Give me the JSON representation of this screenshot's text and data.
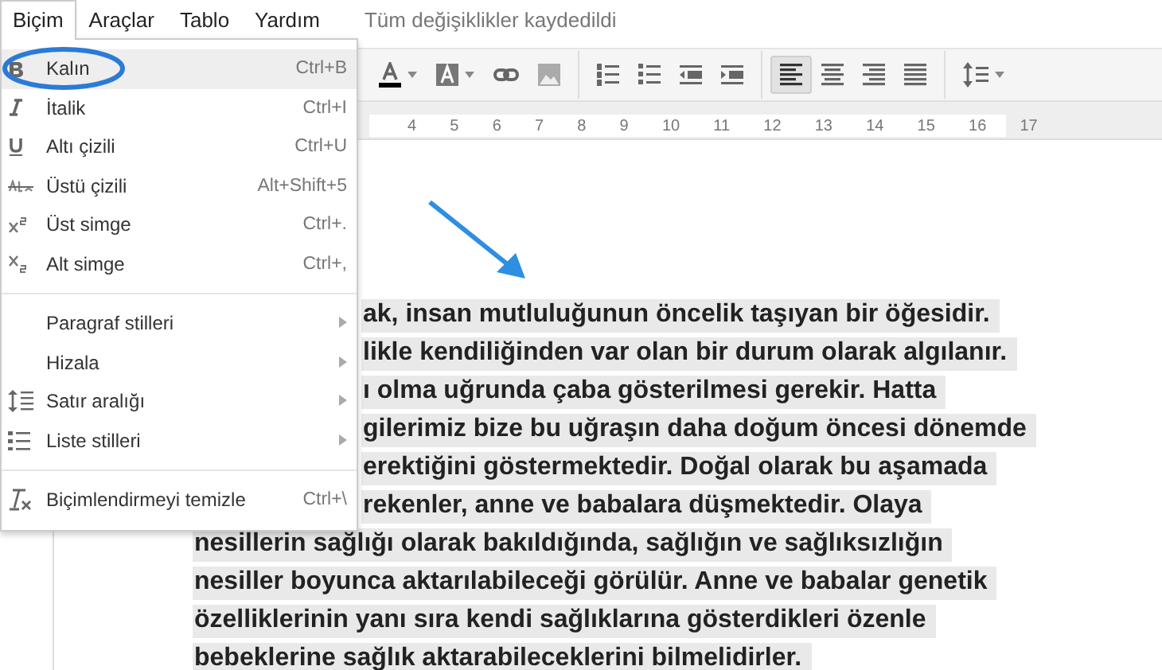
{
  "menubar": {
    "items": [
      {
        "label": "Biçim",
        "selected": true
      },
      {
        "label": "Araçlar",
        "selected": false
      },
      {
        "label": "Tablo",
        "selected": false
      },
      {
        "label": "Yardım",
        "selected": false
      }
    ],
    "status": "Tüm değişiklikler kaydedildi"
  },
  "format_menu": {
    "groups": [
      [
        {
          "kind": "command",
          "label": "Kalın",
          "shortcut": "Ctrl+B",
          "selected": true
        },
        {
          "kind": "command",
          "label": "İtalik",
          "shortcut": "Ctrl+I",
          "selected": false
        },
        {
          "kind": "command",
          "label": "Altı çizili",
          "shortcut": "Ctrl+U",
          "selected": false
        },
        {
          "kind": "command",
          "label": "Üstü çizili",
          "shortcut": "Alt+Shift+5",
          "selected": false
        },
        {
          "kind": "command",
          "label": "Üst simge",
          "shortcut": "Ctrl+.",
          "selected": false
        },
        {
          "kind": "command",
          "label": "Alt simge",
          "shortcut": "Ctrl+,",
          "selected": false
        }
      ],
      [
        {
          "kind": "submenu",
          "label": "Paragraf stilleri",
          "selected": false
        },
        {
          "kind": "submenu",
          "label": "Hizala",
          "selected": false
        },
        {
          "kind": "submenu",
          "label": "Satır aralığı",
          "selected": false
        },
        {
          "kind": "submenu",
          "label": "Liste stilleri",
          "selected": false
        }
      ],
      [
        {
          "kind": "command",
          "label": "Biçimlendirmeyi temizle",
          "shortcut": "Ctrl+\\",
          "selected": false
        }
      ]
    ]
  },
  "toolbar": {
    "align_buttons": [
      {
        "selected": true
      },
      {
        "selected": false
      },
      {
        "selected": false
      },
      {
        "selected": false
      }
    ]
  },
  "ruler": {
    "marks": [
      "4",
      "5",
      "6",
      "7",
      "8",
      "9",
      "10",
      "11",
      "12",
      "13",
      "14",
      "15",
      "16",
      "17"
    ]
  },
  "document": {
    "lines_beside_menu": [
      "ak, insan mutluluğunun öncelik taşıyan bir öğesidir.",
      "likle kendiliğinden var olan bir durum olarak algılanır.",
      "ı olma uğrunda çaba gösterilmesi gerekir. Hatta",
      "gilerimiz bize bu uğraşın daha doğum öncesi dönemde",
      "erektiğini göstermektedir. Doğal olarak bu aşamada",
      "rekenler, anne ve babalara düşmektedir. Olaya"
    ],
    "lines": [
      "nesillerin sağlığı olarak bakıldığında, sağlığın ve sağlıksızlığın",
      "nesiller boyunca aktarılabileceği görülür. Anne ve babalar genetik",
      "özelliklerinin yanı sıra kendi sağlıklarına gösterdikleri özenle",
      "bebeklerine sağlık aktarabileceklerini bilmelidirler."
    ]
  }
}
